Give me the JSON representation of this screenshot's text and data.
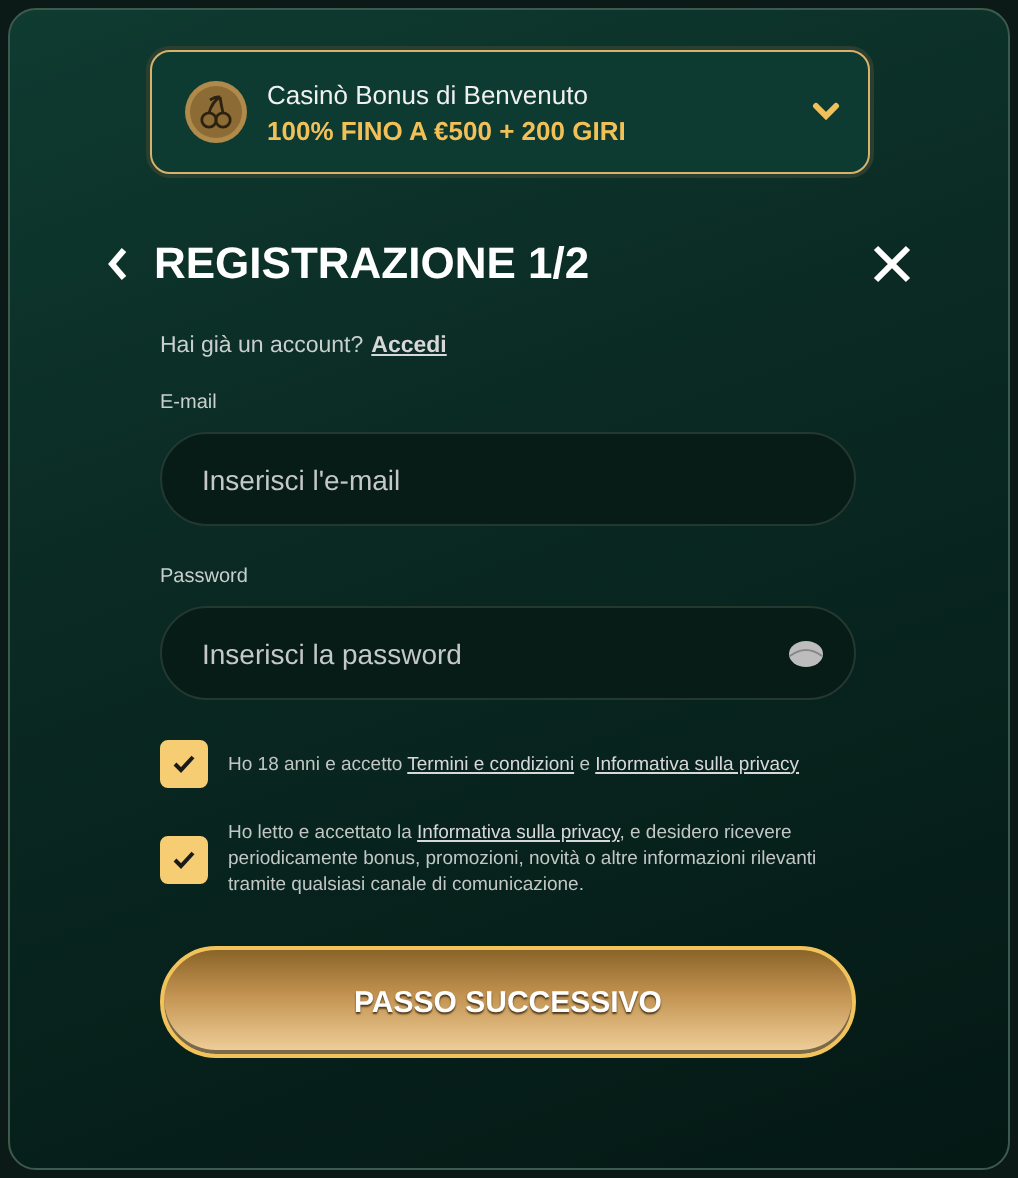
{
  "bonus": {
    "title": "Casinò Bonus di Benvenuto",
    "offer": "100% FINO A €500 + 200 GIRI",
    "expanded": false
  },
  "header": {
    "title": "REGISTRAZIONE 1/2"
  },
  "login_prompt": {
    "text": "Hai già un account?",
    "link": "Accedi"
  },
  "fields": [
    {
      "kind": "email",
      "label": "E-mail",
      "placeholder": "Inserisci l'e-mail"
    },
    {
      "kind": "password",
      "label": "Password",
      "placeholder": "Inserisci la password"
    }
  ],
  "consents": [
    {
      "checked": true,
      "parts": [
        {
          "text": "Ho 18 anni e accetto ",
          "link": false
        },
        {
          "text": "Termini e condizioni",
          "link": true
        },
        {
          "text": " e ",
          "link": false
        },
        {
          "text": "Informativa sulla privacy",
          "link": true
        }
      ]
    },
    {
      "checked": true,
      "parts": [
        {
          "text": "Ho letto e accettato la ",
          "link": false
        },
        {
          "text": "Informativa sulla privacy",
          "link": true
        },
        {
          "text": ", e desidero ricevere periodicamente bonus, promozioni, novità o altre informazioni rilevanti tramite qualsiasi canale di comunicazione.",
          "link": false
        }
      ]
    }
  ],
  "next_button": "PASSO SUCCESSIVO"
}
